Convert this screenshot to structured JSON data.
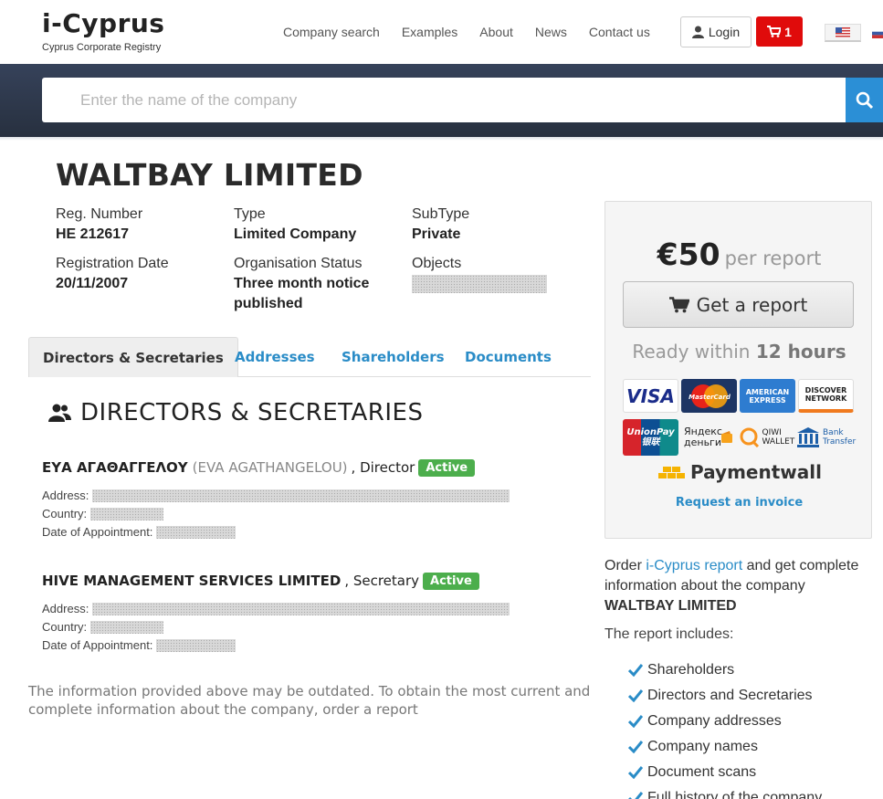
{
  "header": {
    "logo_title": "i-Cyprus",
    "logo_subtitle": "Cyprus Corporate Registry",
    "nav": [
      "Company search",
      "Examples",
      "About",
      "News",
      "Contact us"
    ],
    "login_label": "Login",
    "cart_count": "1"
  },
  "search": {
    "placeholder": "Enter the name of the company"
  },
  "company": {
    "name": "WALTBAY LIMITED",
    "reg_number_label": "Reg. Number",
    "reg_number": "HE 212617",
    "type_label": "Type",
    "type": "Limited Company",
    "subtype_label": "SubType",
    "subtype": "Private",
    "reg_date_label": "Registration Date",
    "reg_date": "20/11/2007",
    "status_label": "Organisation Status",
    "status_line1": "Three month notice",
    "status_line2": "published",
    "objects_label": "Objects"
  },
  "tabs": [
    "Directors & Secretaries",
    "Addresses",
    "Shareholders",
    "Documents"
  ],
  "section_title": "DIRECTORS & SECRETARIES",
  "people": [
    {
      "name": "ΕΥΑ ΑΓΑΘΑΓΓΕΛΟΥ",
      "latin_name": "(EVA AGATHANGELOU)",
      "role": ", Director",
      "status": "Active",
      "address_label": "Address:",
      "country_label": "Country:",
      "appointment_label": "Date of Appointment:"
    },
    {
      "name": "HIVE MANAGEMENT SERVICES LIMITED",
      "latin_name": "",
      "role": ", Secretary",
      "status": "Active",
      "address_label": "Address:",
      "country_label": "Country:",
      "appointment_label": "Date of Appointment:"
    }
  ],
  "disclaimer": "The information provided above may be outdated. To obtain the most current and complete information about the company, order a report",
  "panel": {
    "price": "€50",
    "per_report": "per report",
    "button_label": "Get a report",
    "ready_prefix": "Ready within",
    "ready_hours": "12 hours",
    "payment_methods": [
      "VISA",
      "MasterCard",
      "AMERICAN EXPRESS",
      "DISCOVER NETWORK",
      "UnionPay 银联",
      "Яндекс деньги",
      "QIWI WALLET",
      "Bank Transfer",
      "Paymentwall"
    ],
    "invoice_link": "Request an invoice"
  },
  "info": {
    "order_prefix": "Order",
    "order_link": "i-Cyprus report",
    "order_suffix": "and get complete information about the company",
    "company_name": "WALTBAY LIMITED",
    "includes_label": "The report includes:",
    "includes": [
      "Shareholders",
      "Directors and Secretaries",
      "Company addresses",
      "Company names",
      "Document scans",
      "Full history of the company"
    ]
  },
  "colors": {
    "accent_blue": "#2a8cc7",
    "cart_red": "#e00b0b",
    "active_green": "#4cae4c",
    "band_dark": "#2c3748"
  }
}
